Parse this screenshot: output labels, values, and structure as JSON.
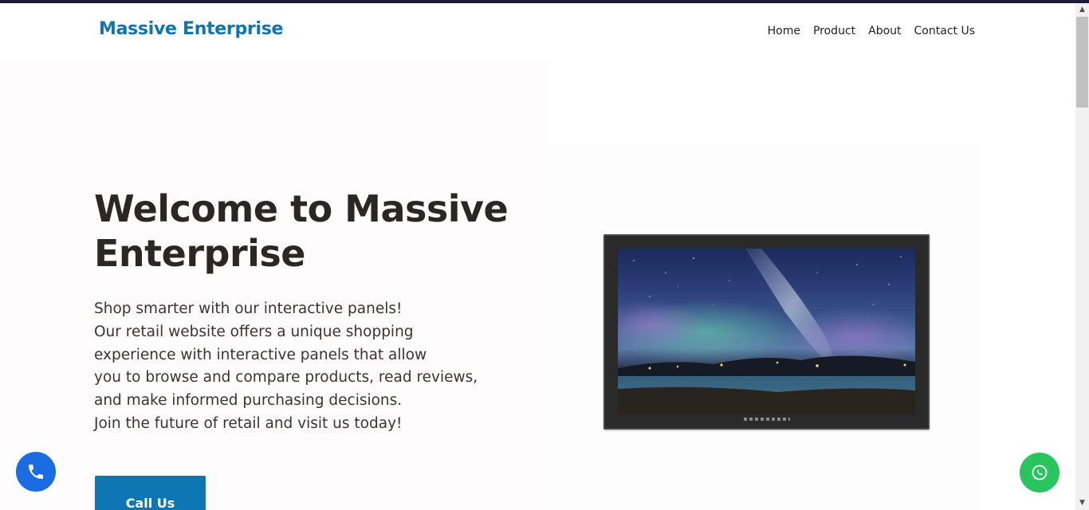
{
  "brand": {
    "name": "Massive Enterprise"
  },
  "nav": {
    "links": [
      "Home",
      "Product",
      "About",
      "Contact Us"
    ]
  },
  "hero": {
    "title": "Welcome to Massive Enterprise",
    "lines": [
      "Shop smarter with our interactive panels!",
      "Our retail website offers a unique shopping",
      "experience with interactive panels that allow",
      "you to browse and compare products, read reviews,",
      "and make informed purchasing decisions.",
      "Join the future of retail and visit us today!"
    ],
    "cta_label": "Call Us"
  },
  "floating": {
    "phone_icon": "phone-icon",
    "whatsapp_icon": "whatsapp-icon"
  },
  "colors": {
    "brand": "#0f75b2",
    "cta": "#0e76b3",
    "phone_fab": "#1a6de0",
    "whatsapp_fab": "#2ac45e",
    "heading": "#2b2722"
  },
  "scrollbar": {
    "up_icon": "▲",
    "down_icon": "▼"
  }
}
